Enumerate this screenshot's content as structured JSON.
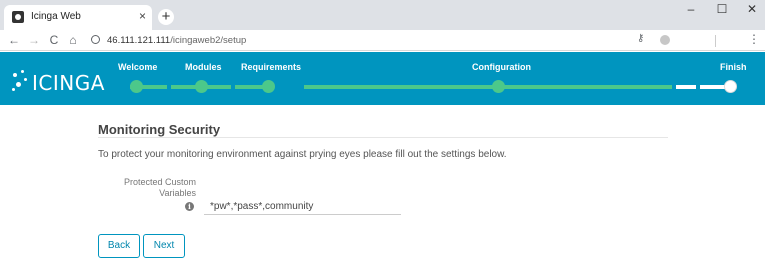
{
  "browser": {
    "tab_title": "Icinga Web",
    "tab_close": "×",
    "new_tab": "+",
    "url_host": "46.111.121.111",
    "url_path": "/icingaweb2/setup",
    "controls": {
      "minimize": "–",
      "maximize": "☐",
      "close": "✕"
    },
    "nav": {
      "back": "←",
      "forward": "→",
      "reload": "C",
      "home": "⌂",
      "menu": "⋮",
      "key": "⚷"
    }
  },
  "header": {
    "logo_text": "ICINGA",
    "background": "#0095bf",
    "progress_color": "#4cc88a",
    "steps": [
      {
        "label": "Welcome"
      },
      {
        "label": "Modules"
      },
      {
        "label": "Requirements"
      },
      {
        "label": "Configuration"
      },
      {
        "label": "Finish"
      }
    ]
  },
  "main": {
    "title": "Monitoring Security",
    "intro": "To protect your monitoring environment against prying eyes please fill out the settings below.",
    "field": {
      "label": "Protected Custom Variables",
      "info_icon": "i",
      "value": "*pw*,*pass*,community"
    },
    "buttons": {
      "back": "Back",
      "next": "Next"
    }
  }
}
